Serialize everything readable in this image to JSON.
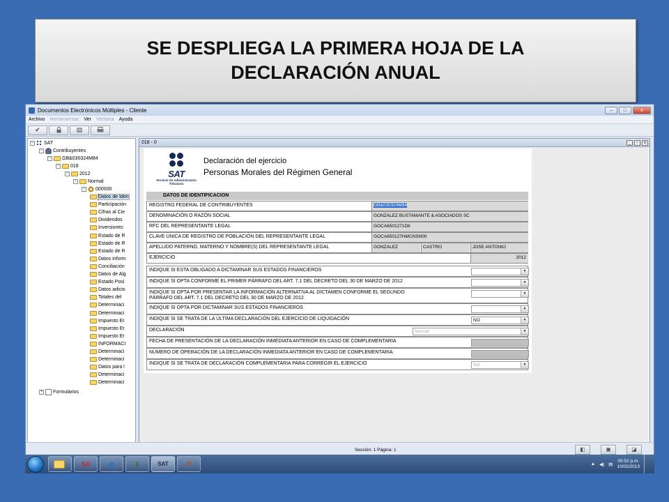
{
  "slide": {
    "title": "SE DESPLIEGA LA PRIMERA HOJA DE LA DECLARACIÓN ANUAL"
  },
  "window": {
    "title": "Documentos Electrónicos Múltiples - Cliente",
    "controls": {
      "minimize": "–",
      "maximize": "□",
      "close": "x"
    }
  },
  "menu": {
    "archivo": "Archivo",
    "herramientas": "Herramientas",
    "ver": "Ver",
    "ventana": "Ventana",
    "ayuda": "Ayuda"
  },
  "toolbar": {
    "check": "✔",
    "lock": "🔒",
    "doc": "▤",
    "print": "▞"
  },
  "tree": {
    "root": "SAT",
    "contribuyentes": "Contribuyentes",
    "rfc": "GB&030324M84",
    "ejercicio_folder": "018",
    "year": "2012",
    "tipo": "Normal",
    "folio": "000000",
    "items": [
      "Datos de Iden",
      "Participación",
      "Cifras al Cie",
      "Dividendos",
      "Inversiones",
      "Estado de R",
      "Estado de R",
      "Estado de R",
      "Datos inform",
      "Conciliación",
      "Datos de Alg",
      "Estado Posi",
      "Datos adicio",
      "Totales del",
      "Determinaci",
      "Determinaci",
      "Impuesto Er",
      "Impuesto Er",
      "Impuesto Er",
      "INFORMACI",
      "Determinaci",
      "Determinaci",
      "Datos para l",
      "Determinaci",
      "Determinaci"
    ],
    "formularios": "Formularios"
  },
  "doc": {
    "tab_title": "018 - 0",
    "sat_word": "SAT",
    "sat_sub": "Servicio de Administración Tributaria",
    "header_title": "Declaración del ejercicio",
    "header_subtitle": "Personas Morales del Régimen General",
    "section": "DATOS DE IDENTIFICACION",
    "rows": {
      "rfc_label": "REGISTRO FEDERAL DE CONTRIBUYENTES",
      "rfc_value": "GB&030324M84",
      "denominacion_label": "DENOMINACIÓN O RAZÓN SOCIAL",
      "denominacion_value": "GONZALEZ BUSTAMANTE & ASOCIADOS SC",
      "rfc_rep_label": "RFC DEL REPRESENTANTE LEGAL",
      "rfc_rep_value": "GOCA6501271D6",
      "curp_label": "CLAVE ÚNICA DE REGISTRO DE POBLACIÓN DEL REPRESENTANTE LEGAL",
      "curp_value": "GOCA650127HMCNSN00",
      "nombre_label": "APELLIDO PATERNO, MATERNO Y NOMBRE(S) DEL REPRESENTANTE LEGAL",
      "paterno": "GONZALEZ",
      "materno": "CASTRO",
      "nombre": "JOSE ANTONIO",
      "ejercicio_label": "EJERCICIO",
      "ejercicio_value": "2012",
      "dictaminar_label": "INDIQUE SI ESTA OBLIGADO A DICTAMINAR SUS ESTADOS FINANCIEROS",
      "opta_primer_label": "INDIQUE SI OPTA CONFORME EL PRIMER PÁRRAFO DEL ART. 7.1 DEL DECRETO DEL 30 DE MARZO DE 2012",
      "opta_alt_label_1": "INDIQUE SI OPTA POR PRESENTAR LA INFORMACIÓN ALTERNATIVA AL DICTAMEN CONFORME EL SEGUNDO",
      "opta_alt_label_2": "PÁRRAFO DEL ART. 7.1 DEL DECRETO DEL 30 DE MARZO DE 2012",
      "opta_dict_label": "INDIQUE SI OPTA POR DICTAMINAR SUS ESTADOS FINANCIEROS",
      "ultima_label": "INDIQUE SI SE TRATA DE LA ÚLTIMA DECLARACIÓN DEL EJERCICIO DE LIQUIDACIÓN",
      "ultima_value": "NO",
      "declaracion_label": "DECLARACIÓN",
      "declaracion_value": "Normal",
      "fecha_label": "FECHA DE PRESENTACIÓN DE LA DECLARACIÓN INMEDIATA ANTERIOR EN CASO DE COMPLEMENTARIA",
      "numero_label": "NÚMERO DE OPERACIÓN DE LA DECLARACIÓN INMEDIATA ANTERIOR EN CASO DE COMPLEMENTARIA",
      "complementaria_label": "INDIQUE SI SE TRATA DE DECLARACIÓN COMPLEMENTARIA PARA CORREGIR EL EJERCICIO",
      "complementaria_value": "NO"
    }
  },
  "status": {
    "text": "Sección: 1 Página: 1"
  },
  "taskbar": {
    "apps": [
      "",
      "SA",
      "e",
      "X",
      "SAT",
      "P"
    ],
    "time": "05:52 p.m.",
    "date": "10/02/2013"
  }
}
